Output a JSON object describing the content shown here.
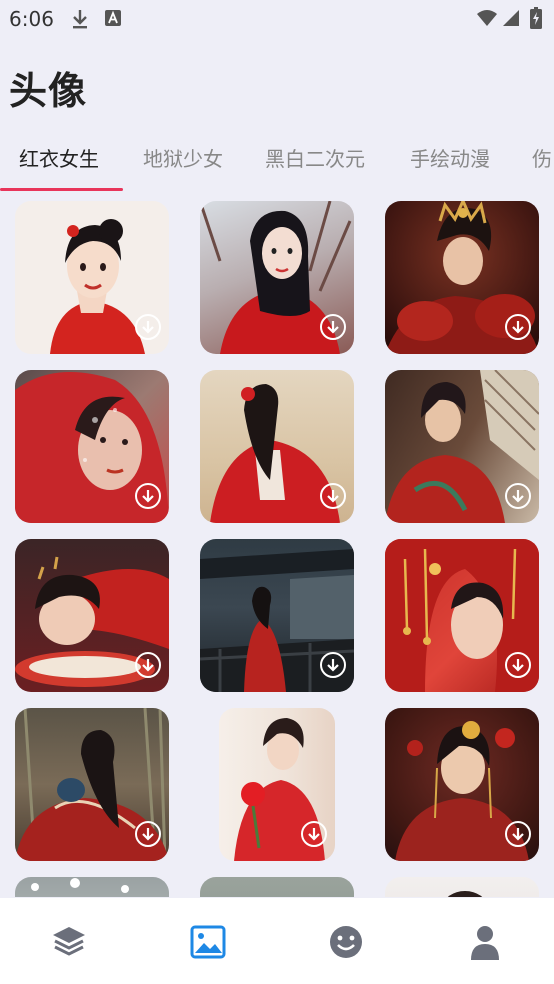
{
  "status_bar": {
    "time": "6:06"
  },
  "page": {
    "title": "头像"
  },
  "tabs": [
    {
      "label": "红衣女生",
      "active": true
    },
    {
      "label": "地狱少女",
      "active": false
    },
    {
      "label": "黑白二次元",
      "active": false
    },
    {
      "label": "手绘动漫",
      "active": false
    },
    {
      "label": "伤",
      "active": false
    }
  ],
  "colors": {
    "accent": "#e8345a",
    "nav_active": "#1e88e5",
    "nav_inactive": "#6b6f7b",
    "page_bg": "#eeeef7"
  },
  "grid": {
    "items": [
      {
        "name": "illustrated-girl-red-hanfu",
        "icon": "download-icon"
      },
      {
        "name": "girl-red-dress-winter-trees",
        "icon": "download-icon"
      },
      {
        "name": "girl-gold-headdress-flowers",
        "icon": "download-icon"
      },
      {
        "name": "girl-red-veil-shadows",
        "icon": "download-icon"
      },
      {
        "name": "girl-red-hanfu-sand",
        "icon": "download-icon"
      },
      {
        "name": "girl-red-costume-window",
        "icon": "download-icon"
      },
      {
        "name": "girl-lying-red-hanfu",
        "icon": "download-icon"
      },
      {
        "name": "girl-red-dress-courtyard",
        "icon": "download-icon"
      },
      {
        "name": "girl-red-veil-gold-ornaments",
        "icon": "download-icon"
      },
      {
        "name": "girl-red-hanfu-bamboo-fan",
        "icon": "download-icon"
      },
      {
        "name": "girl-red-dress-holding-rose",
        "icon": "download-icon"
      },
      {
        "name": "girl-red-costume-flowers",
        "icon": "download-icon"
      }
    ]
  },
  "bottom_nav": [
    {
      "name": "layers-icon",
      "active": false
    },
    {
      "name": "gallery-icon",
      "active": true
    },
    {
      "name": "smiley-icon",
      "active": false
    },
    {
      "name": "profile-icon",
      "active": false
    }
  ]
}
